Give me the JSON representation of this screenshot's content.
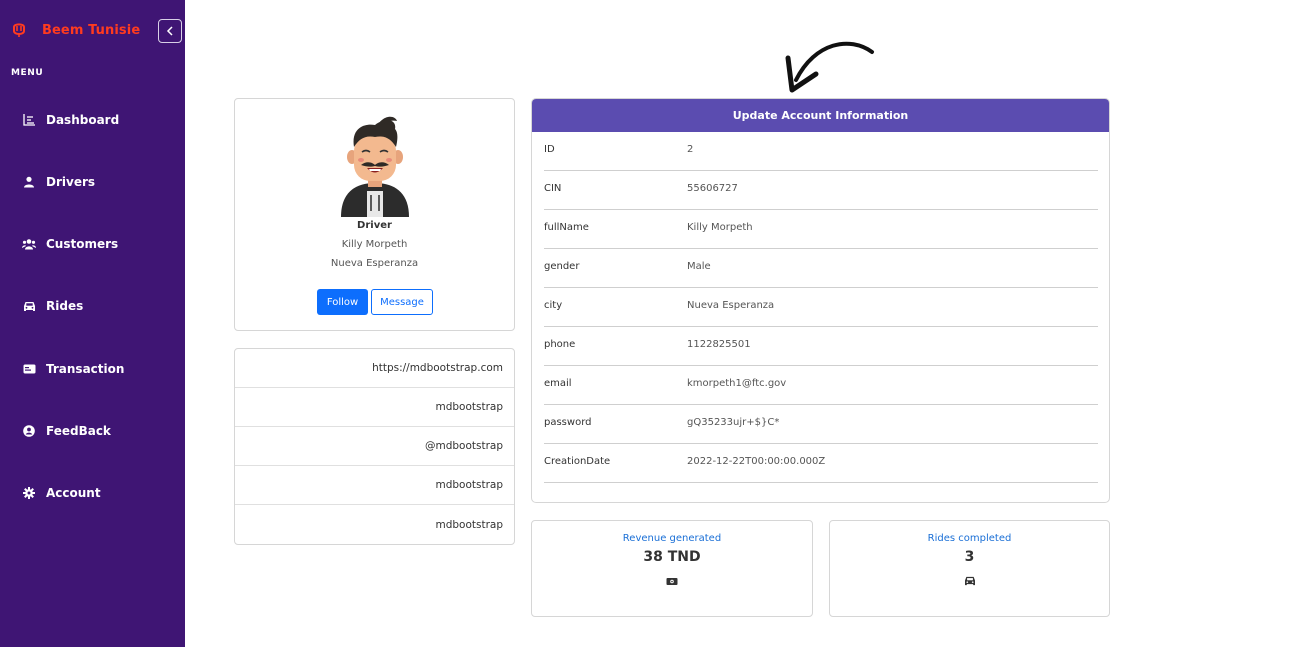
{
  "brand": {
    "name": "Beem Tunisie",
    "color": "#ff3b1f"
  },
  "sidebar": {
    "menu_label": "MENU",
    "background": "#3f1574",
    "items": [
      {
        "label": "Dashboard",
        "icon": "chart-icon"
      },
      {
        "label": "Drivers",
        "icon": "user-icon"
      },
      {
        "label": "Customers",
        "icon": "users-icon"
      },
      {
        "label": "Rides",
        "icon": "car-icon"
      },
      {
        "label": "Transaction",
        "icon": "card-icon"
      },
      {
        "label": "FeedBack",
        "icon": "user-circle-icon"
      },
      {
        "label": "Account",
        "icon": "gear-icon"
      }
    ]
  },
  "profile": {
    "role": "Driver",
    "name": "Killy Morpeth",
    "city": "Nueva Esperanza",
    "follow_label": "Follow",
    "message_label": "Message"
  },
  "links": [
    "https://mdbootstrap.com",
    "mdbootstrap",
    "@mdbootstrap",
    "mdbootstrap",
    "mdbootstrap"
  ],
  "account": {
    "title": "Update Account Information",
    "header_color": "#5b4cb0",
    "fields": [
      {
        "key": "ID",
        "value": "2"
      },
      {
        "key": "CIN",
        "value": "55606727"
      },
      {
        "key": "fullName",
        "value": "Killy Morpeth"
      },
      {
        "key": "gender",
        "value": "Male"
      },
      {
        "key": "city",
        "value": "Nueva Esperanza"
      },
      {
        "key": "phone",
        "value": "1122825501"
      },
      {
        "key": "email",
        "value": "kmorpeth1@ftc.gov"
      },
      {
        "key": "password",
        "value": "gQ35233ujr+$}C*"
      },
      {
        "key": "CreationDate",
        "value": "2022-12-22T00:00:00.000Z"
      }
    ]
  },
  "stats": {
    "revenue": {
      "label": "Revenue generated",
      "value": "38 TND",
      "icon": "money-icon"
    },
    "rides": {
      "label": "Rides completed",
      "value": "3",
      "icon": "car-icon"
    }
  }
}
